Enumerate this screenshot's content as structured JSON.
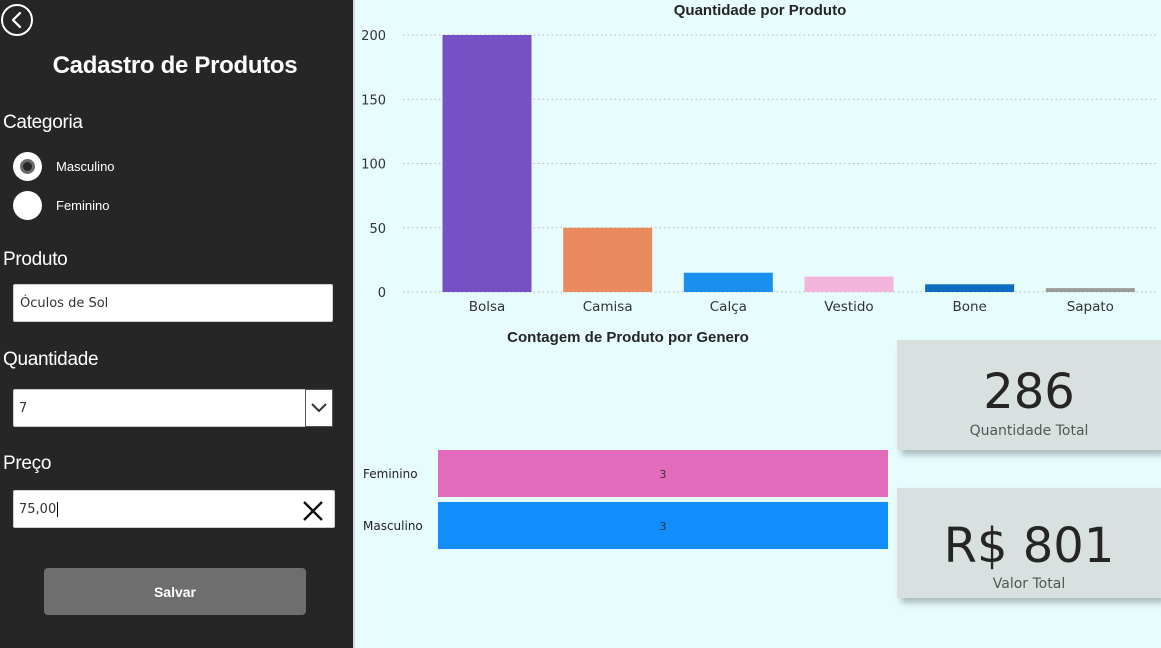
{
  "form": {
    "title": "Cadastro de Produtos",
    "categoria_label": "Categoria",
    "categoria_options": [
      {
        "label": "Masculino",
        "selected": true
      },
      {
        "label": "Feminino",
        "selected": false
      }
    ],
    "produto_label": "Produto",
    "produto_value": "Óculos de Sol",
    "quantidade_label": "Quantidade",
    "quantidade_value": "7",
    "preco_label": "Preço",
    "preco_value": "75,00",
    "save_label": "Salvar",
    "icons": {
      "back": "back-arrow-icon",
      "dropdown": "chevron-down-icon",
      "clear": "close-icon"
    }
  },
  "colors": {
    "panel_bg": "#262626",
    "dashboard_bg": "#e6fcfd",
    "card_bg": "#d9e1e0",
    "save_button_bg": "#6e6e6e"
  },
  "chart_data": [
    {
      "type": "bar",
      "title": "Quantidade por Produto",
      "categories": [
        "Bolsa",
        "Camisa",
        "Calça",
        "Vestido",
        "Bone",
        "Sapato"
      ],
      "values": [
        200,
        50,
        15,
        12,
        6,
        3
      ],
      "colors": [
        "#7651c4",
        "#e98a5f",
        "#1b8ff0",
        "#f3b5dd",
        "#0d6cc0",
        "#9a9a9a"
      ],
      "ylim": [
        0,
        200
      ],
      "yticks": [
        0,
        50,
        100,
        150,
        200
      ],
      "grid": true
    },
    {
      "type": "bar",
      "orientation": "horizontal",
      "title": "Contagem de Produto por Genero",
      "categories": [
        "Feminino",
        "Masculino"
      ],
      "values": [
        3,
        3
      ],
      "colors": [
        "#e36bbb",
        "#118dfe"
      ]
    }
  ],
  "cards": [
    {
      "value": "286",
      "label": "Quantidade Total"
    },
    {
      "value": "R$ 801",
      "label": "Valor Total"
    }
  ]
}
